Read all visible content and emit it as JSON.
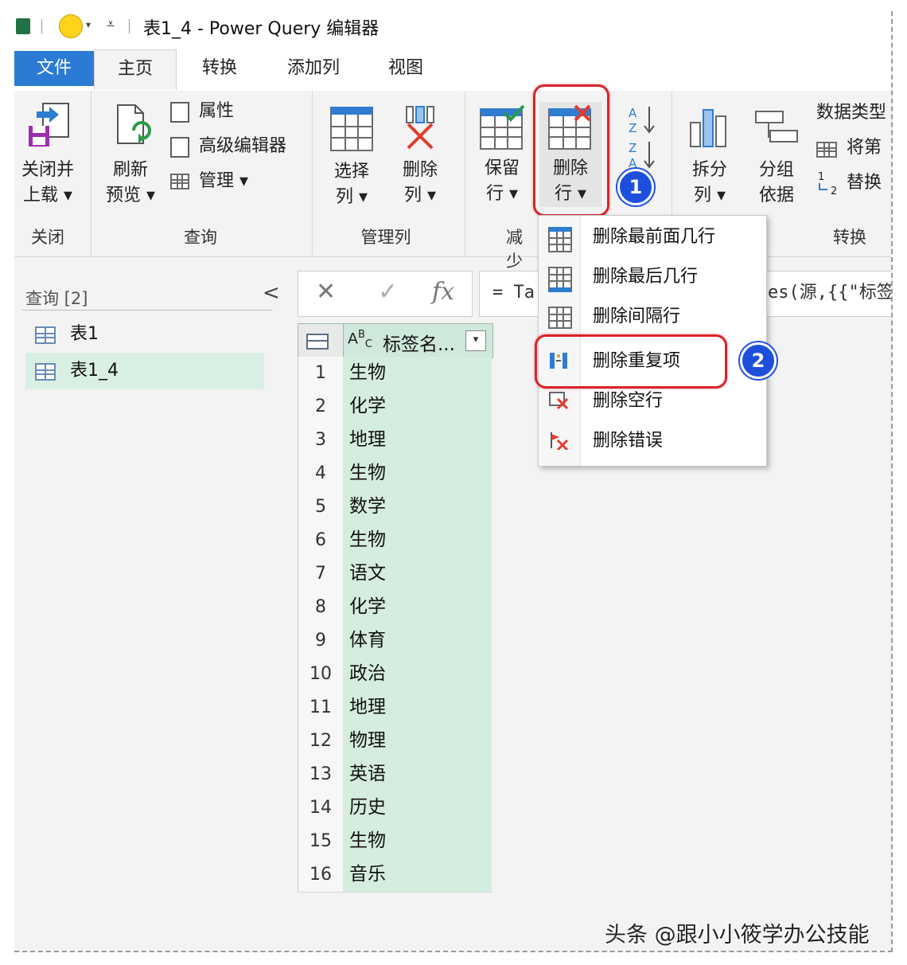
{
  "title_bar": {
    "title": "表1_4 - Power Query 编辑器",
    "quick_access_arrow": "▾",
    "customize_glyph": "⩡"
  },
  "tabs": [
    {
      "label": "文件",
      "kind": "file"
    },
    {
      "label": "主页",
      "kind": "active"
    },
    {
      "label": "转换",
      "kind": "normal"
    },
    {
      "label": "添加列",
      "kind": "normal"
    },
    {
      "label": "视图",
      "kind": "normal"
    }
  ],
  "ribbon": {
    "close_group": {
      "button_line1": "关闭并",
      "button_line2": "上载 ▾",
      "label": "关闭",
      "icon": "close-and-load-icon"
    },
    "query_group": {
      "refresh_line1": "刷新",
      "refresh_line2": "预览 ▾",
      "properties": "属性",
      "advanced_editor": "高级编辑器",
      "manage": "管理 ▾",
      "label": "查询"
    },
    "manage_columns_group": {
      "choose_line1": "选择",
      "choose_line2": "列 ▾",
      "remove_line1": "删除",
      "remove_line2": "列 ▾",
      "label": "管理列"
    },
    "reduce_rows_group": {
      "keep_line1": "保留",
      "keep_line2": "行 ▾",
      "remove_rows_line1": "删除",
      "remove_rows_line2": "行 ▾",
      "label_partial": "减少"
    },
    "sort_group": {
      "asc_icon": "sort-ascending-icon",
      "desc_icon": "sort-descending-icon"
    },
    "transform_group": {
      "split_line1": "拆分",
      "split_line2": "列 ▾",
      "group_line1": "分组",
      "group_line2": "依据",
      "data_type": "数据类型",
      "first_row": "将第",
      "replace": "替换",
      "label": "转换"
    }
  },
  "callouts": {
    "step1": "1",
    "step2": "2",
    "ring_color": "#d9242a",
    "badge_color": "#1d4fdc"
  },
  "queries_pane": {
    "header": "查询 [2]",
    "collapse_glyph": "<",
    "items": [
      {
        "name": "表1",
        "selected": false
      },
      {
        "name": "表1_4",
        "selected": true
      }
    ]
  },
  "formula_bar": {
    "cancel_glyph": "✕",
    "commit_glyph": "✓",
    "fx": "fx",
    "formula_left": "= Ta",
    "formula_right": "es(源,{{\"标签"
  },
  "grid": {
    "type_glyph_a": "A",
    "type_glyph_b": "B",
    "type_glyph_c": "C",
    "column_name": "标签名...",
    "dropdown_glyph": "▾",
    "rows": [
      {
        "n": "1",
        "v": "生物"
      },
      {
        "n": "2",
        "v": "化学"
      },
      {
        "n": "3",
        "v": "地理"
      },
      {
        "n": "4",
        "v": "生物"
      },
      {
        "n": "5",
        "v": "数学"
      },
      {
        "n": "6",
        "v": "生物"
      },
      {
        "n": "7",
        "v": "语文"
      },
      {
        "n": "8",
        "v": "化学"
      },
      {
        "n": "9",
        "v": "体育"
      },
      {
        "n": "10",
        "v": "政治"
      },
      {
        "n": "11",
        "v": "地理"
      },
      {
        "n": "12",
        "v": "物理"
      },
      {
        "n": "13",
        "v": "英语"
      },
      {
        "n": "14",
        "v": "历史"
      },
      {
        "n": "15",
        "v": "生物"
      },
      {
        "n": "16",
        "v": "音乐"
      }
    ]
  },
  "remove_rows_menu": {
    "items": [
      {
        "label": "删除最前面几行",
        "icon": "remove-top-rows-icon"
      },
      {
        "label": "删除最后几行",
        "icon": "remove-bottom-rows-icon"
      },
      {
        "label": "删除间隔行",
        "icon": "remove-alternate-rows-icon"
      },
      {
        "label": "删除重复项",
        "icon": "remove-duplicates-icon"
      },
      {
        "label": "删除空行",
        "icon": "remove-blank-rows-icon"
      },
      {
        "label": "删除错误",
        "icon": "remove-errors-icon"
      }
    ]
  },
  "watermark": "头条 @跟小小筱学办公技能"
}
